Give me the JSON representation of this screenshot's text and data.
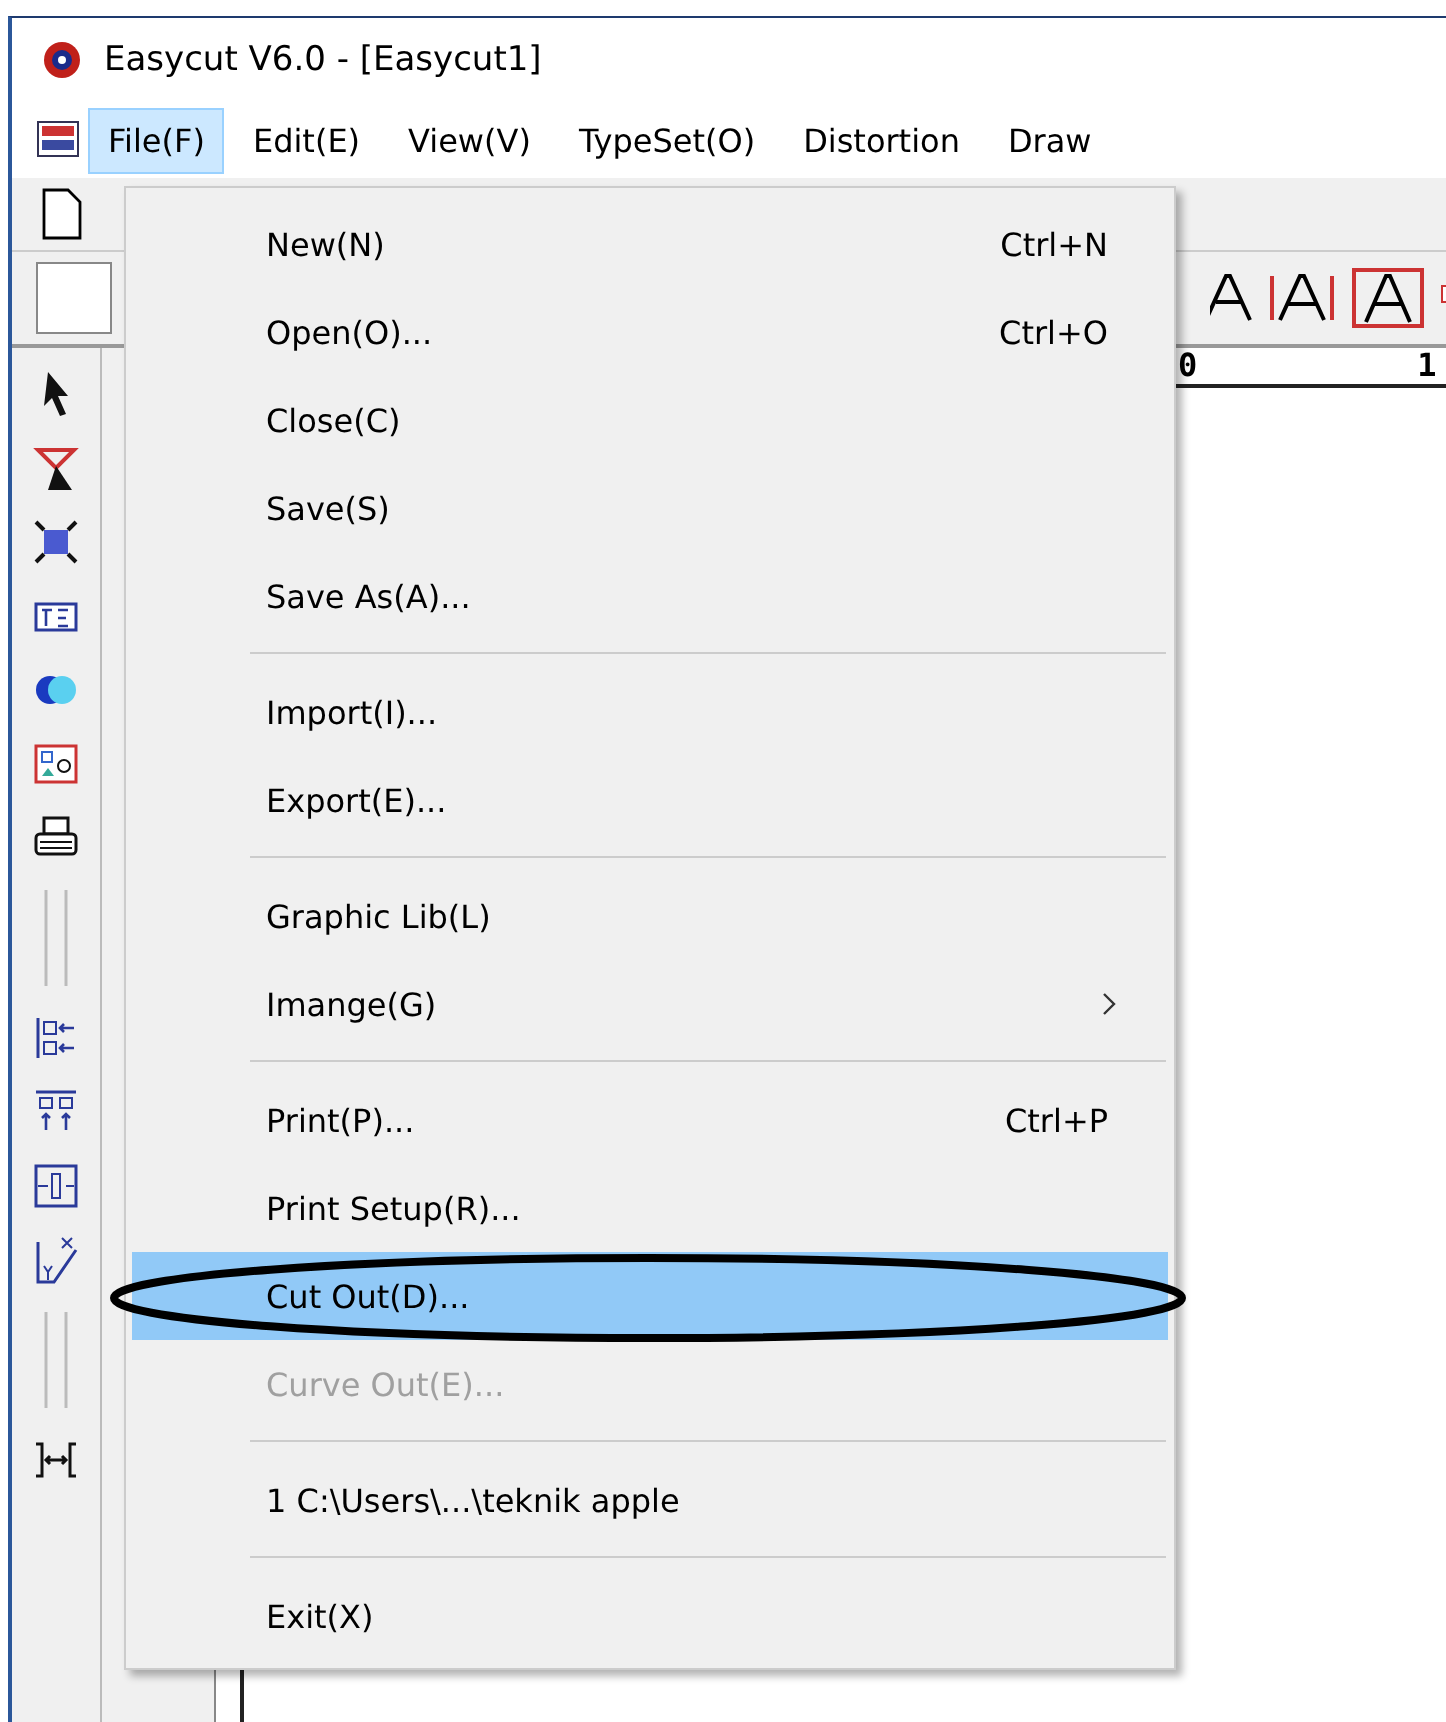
{
  "window": {
    "title": "Easycut V6.0 - [Easycut1]"
  },
  "menubar": [
    {
      "label": "File(F)",
      "selected": true
    },
    {
      "label": "Edit(E)",
      "selected": false
    },
    {
      "label": "View(V)",
      "selected": false
    },
    {
      "label": "TypeSet(O)",
      "selected": false
    },
    {
      "label": "Distortion",
      "selected": false
    },
    {
      "label": "Draw",
      "selected": false
    }
  ],
  "ruler": {
    "labels": [
      "0",
      "1"
    ]
  },
  "file_menu": [
    {
      "kind": "item",
      "label": "New(N)",
      "shortcut": "Ctrl+N",
      "disabled": false,
      "selected": false
    },
    {
      "kind": "item",
      "label": "Open(O)...",
      "shortcut": "Ctrl+O",
      "disabled": false,
      "selected": false
    },
    {
      "kind": "item",
      "label": "Close(C)",
      "disabled": false,
      "selected": false
    },
    {
      "kind": "item",
      "label": "Save(S)",
      "disabled": false,
      "selected": false
    },
    {
      "kind": "item",
      "label": "Save As(A)...",
      "disabled": false,
      "selected": false
    },
    {
      "kind": "separator"
    },
    {
      "kind": "item",
      "label": "Import(I)...",
      "disabled": false,
      "selected": false
    },
    {
      "kind": "item",
      "label": "Export(E)...",
      "disabled": false,
      "selected": false
    },
    {
      "kind": "separator"
    },
    {
      "kind": "item",
      "label": "Graphic Lib(L)",
      "disabled": false,
      "selected": false
    },
    {
      "kind": "submenu",
      "label": "Imange(G)",
      "disabled": false,
      "selected": false
    },
    {
      "kind": "separator"
    },
    {
      "kind": "item",
      "label": "Print(P)...",
      "shortcut": "Ctrl+P",
      "disabled": false,
      "selected": false
    },
    {
      "kind": "item",
      "label": "Print Setup(R)...",
      "disabled": false,
      "selected": false
    },
    {
      "kind": "item",
      "label": "Cut Out(D)...",
      "disabled": false,
      "selected": true
    },
    {
      "kind": "item",
      "label": "Curve Out(E)...",
      "disabled": true,
      "selected": false
    },
    {
      "kind": "separator"
    },
    {
      "kind": "item",
      "label": "1 C:\\Users\\...\\teknik apple",
      "disabled": false,
      "selected": false
    },
    {
      "kind": "separator"
    },
    {
      "kind": "item",
      "label": "Exit(X)",
      "disabled": false,
      "selected": false
    }
  ],
  "annotation": {
    "kind": "ellipse"
  }
}
